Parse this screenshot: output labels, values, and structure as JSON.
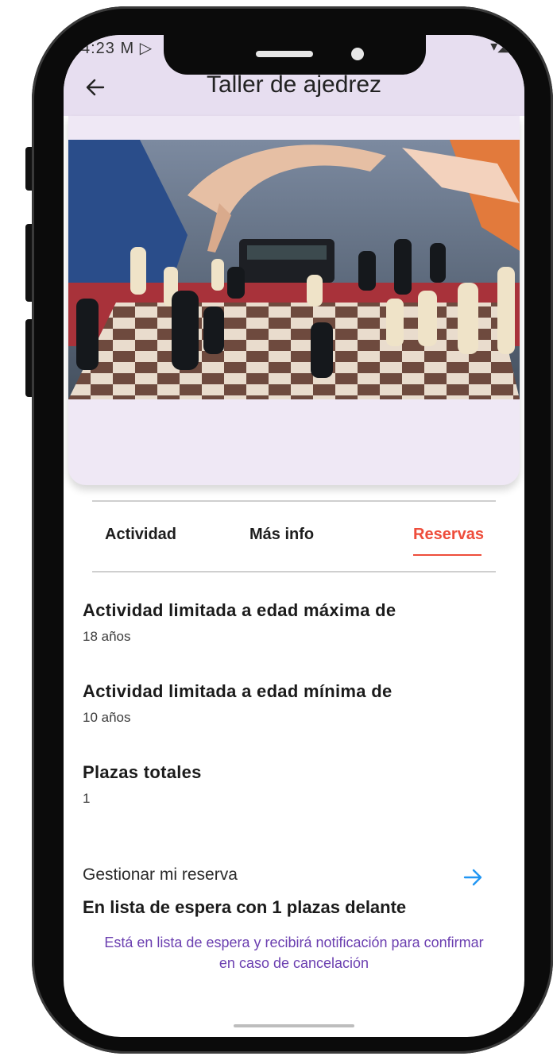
{
  "status_bar": {
    "time": "4:23",
    "left_icons": "M ▷",
    "right_icons": "▾◢▮"
  },
  "appbar": {
    "back_icon": "arrow-left-icon",
    "title": "Taller de ajedrez"
  },
  "tabs": [
    {
      "label": "Actividad",
      "active": false
    },
    {
      "label": "Más info",
      "active": false
    },
    {
      "label": "Reservas",
      "active": true
    }
  ],
  "details": {
    "max_age_title": "Actividad limitada a edad máxima de",
    "max_age_value": "18 años",
    "min_age_title": "Actividad limitada a edad mínima de",
    "min_age_value": "10 años",
    "total_places_title": "Plazas totales",
    "total_places_value": "1"
  },
  "manage": {
    "label": "Gestionar mi reserva",
    "arrow_icon": "arrow-right-icon"
  },
  "waitlist": {
    "title": "En lista de espera con  1 plazas delante",
    "note": "Está en lista de espera y recibirá notificación para confirmar en caso de cancelación"
  },
  "colors": {
    "appbar": "#e7def0",
    "active_tab": "#ee4d3b",
    "link_arrow": "#2196f3",
    "note_text": "#6b3fb0"
  }
}
